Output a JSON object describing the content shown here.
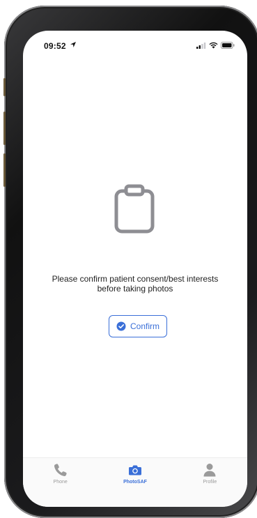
{
  "status_bar": {
    "time": "09:52"
  },
  "main": {
    "message": "Please confirm patient consent/best interests before taking photos",
    "confirm_label": "Confirm"
  },
  "tab_bar": {
    "tabs": [
      {
        "label": "Phone",
        "icon": "phone-icon",
        "active": false
      },
      {
        "label": "PhotoSAF",
        "icon": "camera-icon",
        "active": true
      },
      {
        "label": "Profile",
        "icon": "person-icon",
        "active": false
      }
    ]
  },
  "colors": {
    "accent": "#3a6fd8",
    "inactive": "#9a9a9a",
    "clipboard": "#8e8e93"
  }
}
